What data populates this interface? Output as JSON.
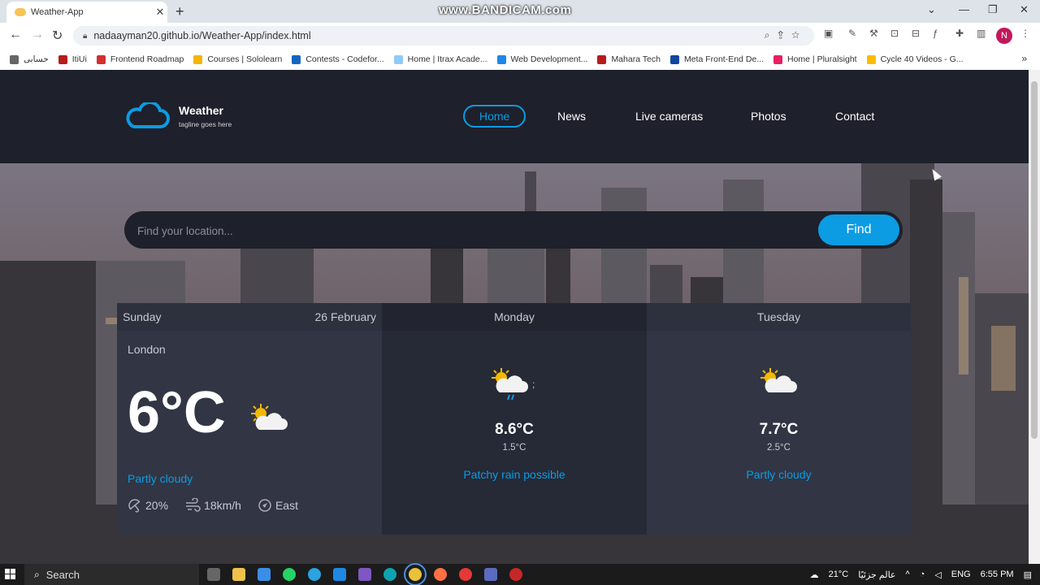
{
  "browser": {
    "tab_title": "Weather-App",
    "url": "nadaayman20.github.io/Weather-App/index.html",
    "watermark": "www.BANDICAM.com",
    "profile_initial": "N",
    "bookmarks": [
      {
        "label": "حسابی",
        "color": "#666666"
      },
      {
        "label": "ItiUi",
        "color": "#b71c1c"
      },
      {
        "label": "Frontend Roadmap",
        "color": "#d32f2f"
      },
      {
        "label": "Courses | Sololearn",
        "color": "#f4b400"
      },
      {
        "label": "Contests - Codefor...",
        "color": "#1565c0"
      },
      {
        "label": "Home | Itrax Acade...",
        "color": "#90caf9"
      },
      {
        "label": "Web Development...",
        "color": "#1e88e5"
      },
      {
        "label": "Mahara Tech",
        "color": "#b71c1c"
      },
      {
        "label": "Meta Front-End De...",
        "color": "#0d47a1"
      },
      {
        "label": "Home | Pluralsight",
        "color": "#e91e63"
      },
      {
        "label": "Cycle 40 Videos - G...",
        "color": "#fbbc04"
      }
    ]
  },
  "site": {
    "brand": {
      "name": "Weather",
      "tagline": "tagline goes here"
    },
    "nav": [
      {
        "label": "Home",
        "active": true
      },
      {
        "label": "News",
        "active": false
      },
      {
        "label": "Live cameras",
        "active": false
      },
      {
        "label": "Photos",
        "active": false
      },
      {
        "label": "Contact",
        "active": false
      }
    ],
    "search": {
      "placeholder": "Find your location...",
      "button": "Find"
    },
    "today": {
      "day": "Sunday",
      "date": "26 February",
      "location": "London",
      "temp": "6°C",
      "condition": "Partly cloudy",
      "rain": "20%",
      "wind": "18km/h",
      "direction": "East"
    },
    "forecast": [
      {
        "day": "Monday",
        "max": "8.6°C",
        "min": "1.5°C",
        "condition": "Patchy rain possible",
        "icon": "sun-cloud-rain-icon",
        "stray": ";"
      },
      {
        "day": "Tuesday",
        "max": "7.7°C",
        "min": "2.5°C",
        "condition": "Partly cloudy",
        "icon": "sun-cloud-icon"
      }
    ],
    "colors": {
      "accent": "#0b9ce3",
      "header_bg": "#1e202b",
      "card_bg": "#323544"
    }
  },
  "taskbar": {
    "search_label": "Search",
    "weather": "21°C",
    "weather_text": "عالم جزئيًا",
    "language": "ENG",
    "time": "6:55 PM"
  }
}
